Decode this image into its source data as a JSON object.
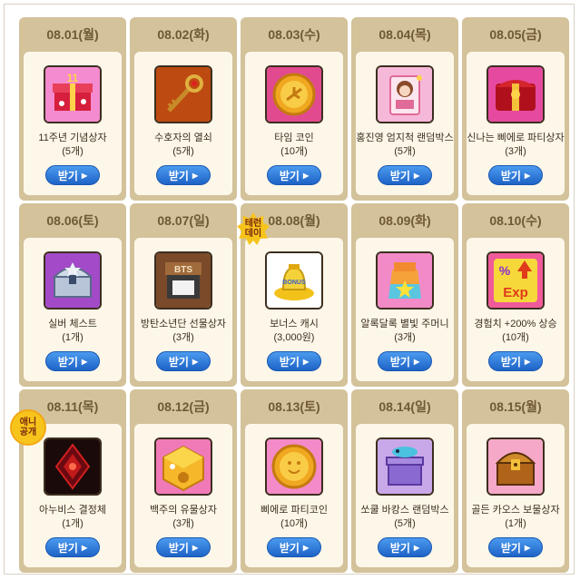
{
  "calendar": {
    "button_label": "받기",
    "days": [
      {
        "date": "08.01(월)",
        "name": "11주년 기념상자",
        "qty": "(5개)",
        "icon": "anniversary-box-icon"
      },
      {
        "date": "08.02(화)",
        "name": "수호자의 열쇠",
        "qty": "(5개)",
        "icon": "guardian-key-icon"
      },
      {
        "date": "08.03(수)",
        "name": "타임 코인",
        "qty": "(10개)",
        "icon": "time-coin-icon"
      },
      {
        "date": "08.04(목)",
        "name": "홍진영 엄지척 랜덤박스",
        "qty": "(5개)",
        "icon": "random-box-icon"
      },
      {
        "date": "08.05(금)",
        "name": "신나는 삐에로 파티상자",
        "qty": "(3개)",
        "icon": "party-box-icon"
      },
      {
        "date": "08.06(토)",
        "name": "실버 체스트",
        "qty": "(1개)",
        "icon": "silver-chest-icon"
      },
      {
        "date": "08.07(일)",
        "name": "방탄소년단 선물상자",
        "qty": "(3개)",
        "icon": "bts-gift-box-icon"
      },
      {
        "date": "08.08(월)",
        "name": "보너스 캐시",
        "qty": "(3,000원)",
        "icon": "bonus-cash-icon",
        "badge": "테런\n데이"
      },
      {
        "date": "08.09(화)",
        "name": "알록달록 별빛 주머니",
        "qty": "(3개)",
        "icon": "starlight-pouch-icon"
      },
      {
        "date": "08.10(수)",
        "name": "경험치 +200% 상승",
        "qty": "(10개)",
        "icon": "exp-boost-icon"
      },
      {
        "date": "08.11(목)",
        "name": "아누비스 결정체",
        "qty": "(1개)",
        "icon": "anubis-crystal-icon",
        "badge": "애니\n공개"
      },
      {
        "date": "08.12(금)",
        "name": "백주의 유물상자",
        "qty": "(3개)",
        "icon": "relic-box-icon"
      },
      {
        "date": "08.13(토)",
        "name": "삐에로 파티코인",
        "qty": "(10개)",
        "icon": "party-coin-icon"
      },
      {
        "date": "08.14(일)",
        "name": "쏘쿨 바캉스 랜덤박스",
        "qty": "(5개)",
        "icon": "vacance-box-icon"
      },
      {
        "date": "08.15(월)",
        "name": "골든 카오스 보물상자",
        "qty": "(1개)",
        "icon": "chaos-treasure-icon"
      }
    ]
  },
  "colors": {
    "cell_bg": "#d3c29a",
    "card_bg": "#fdf7e9",
    "button_blue": "#1e63c7",
    "badge_yellow": "#f7c41c"
  }
}
